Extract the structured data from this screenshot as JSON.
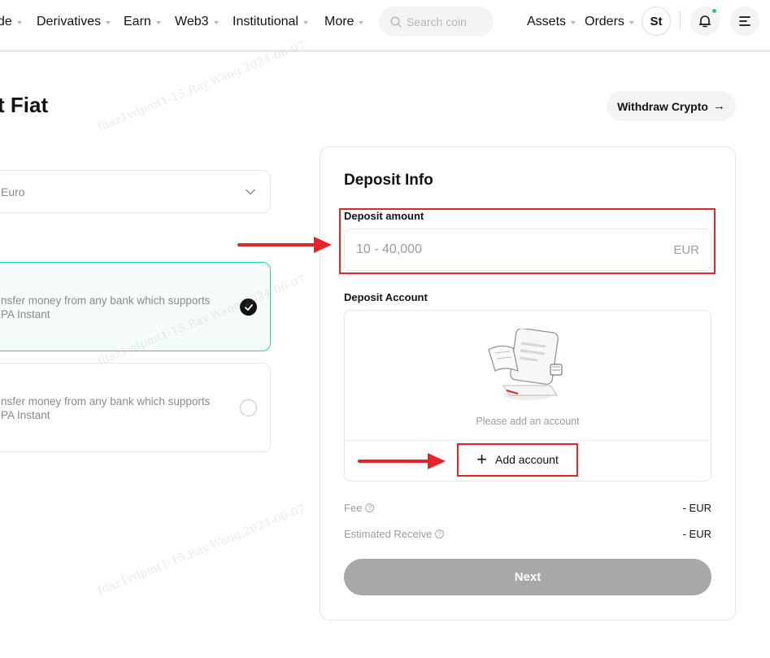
{
  "nav": {
    "items": [
      {
        "label": "de"
      },
      {
        "label": "Derivatives"
      },
      {
        "label": "Earn"
      },
      {
        "label": "Web3"
      },
      {
        "label": "Institutional"
      },
      {
        "label": "More"
      }
    ],
    "search_placeholder": "Search coin",
    "assets_label": "Assets",
    "orders_label": "Orders",
    "avatar_initials": "St",
    "notification_dot_color": "#22c39a"
  },
  "page": {
    "title": "t Fiat",
    "withdraw_label": "Withdraw Crypto",
    "currency_value": "Euro"
  },
  "methods": [
    {
      "line1": "nsfer money from any  bank which supports",
      "line2": "PA Instant",
      "selected": true
    },
    {
      "line1": "nsfer money from any  bank which supports",
      "line2": "PA Instant",
      "selected": false
    }
  ],
  "deposit_info": {
    "title": "Deposit Info",
    "amount_label": "Deposit amount",
    "amount_placeholder": "10 - 40,000",
    "amount_value": "",
    "amount_unit": "EUR",
    "account_label": "Deposit Account",
    "empty_text": "Please add an account",
    "add_account_label": "Add account",
    "fee_label": "Fee",
    "fee_value": "- EUR",
    "receive_label": "Estimated Receive",
    "receive_value": "- EUR",
    "next_label": "Next"
  },
  "watermark": "fdaz1vdpmt1-15.Ray.Wang.2024-06-07",
  "colors": {
    "accent": "#2ed3a4",
    "annotation": "#e3242b",
    "button_disabled": "#a8a8a8"
  }
}
